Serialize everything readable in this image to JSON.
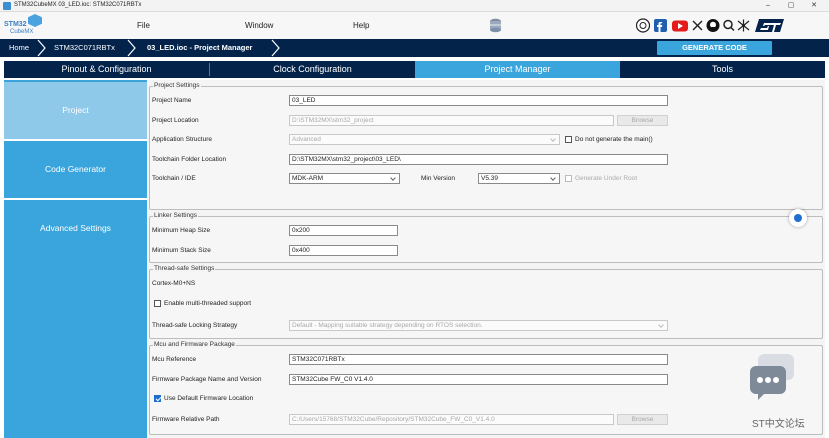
{
  "window": {
    "title": "STM32CubeMX 03_LED.ioc: STM32C071RBTx",
    "minimize": "–",
    "maximize": "▢",
    "close": "✕"
  },
  "logo": {
    "line1": "STM32",
    "line2": "CubeMX"
  },
  "menu": {
    "file": "File",
    "window": "Window",
    "help": "Help"
  },
  "breadcrumb": {
    "home": "Home",
    "mcu": "STM32C071RBTx",
    "project": "03_LED.ioc - Project Manager",
    "generate": "GENERATE CODE"
  },
  "tabs": [
    {
      "label": "Pinout & Configuration"
    },
    {
      "label": "Clock Configuration"
    },
    {
      "label": "Project Manager"
    },
    {
      "label": "Tools"
    }
  ],
  "sidenav": [
    {
      "label": "Project"
    },
    {
      "label": "Code Generator"
    },
    {
      "label": "Advanced Settings"
    }
  ],
  "project_settings": {
    "title": "Project Settings",
    "project_name_label": "Project Name",
    "project_name": "03_LED",
    "project_location_label": "Project Location",
    "project_location": "D:\\STM32MX\\stm32_project",
    "browse": "Browse",
    "app_structure_label": "Application Structure",
    "app_structure": "Advanced",
    "no_main_label": "Do not generate the main()",
    "toolchain_folder_label": "Toolchain Folder Location",
    "toolchain_folder": "D:\\STM32MX\\stm32_project\\03_LED\\",
    "toolchain_ide_label": "Toolchain / IDE",
    "toolchain_ide": "MDK-ARM",
    "min_version_label": "Min Version",
    "min_version": "V5.39",
    "gen_under_root_label": "Generate Under Root"
  },
  "linker_settings": {
    "title": "Linker Settings",
    "heap_label": "Minimum Heap Size",
    "heap": "0x200",
    "stack_label": "Minimum Stack Size",
    "stack": "0x400"
  },
  "thread_safe": {
    "title": "Thread-safe Settings",
    "core": "Cortex-M0+NS",
    "multi_label": "Enable multi-threaded support",
    "strategy_label": "Thread-safe Locking Strategy",
    "strategy": "Default - Mapping suitable strategy depending on RTOS selection."
  },
  "mcu_fw": {
    "title": "Mcu and Firmware Package",
    "mcu_ref_label": "Mcu Reference",
    "mcu_ref": "STM32C071RBTx",
    "fw_name_label": "Firmware Package Name and Version",
    "fw_name": "STM32Cube FW_C0 V1.4.0",
    "default_loc_label": "Use Default Firmware Location",
    "rel_path_label": "Firmware Relative Path",
    "rel_path": "C:/Users/15768/STM32Cube/Repository/STM32Cube_FW_C0_V1.4.0",
    "browse": "Browse"
  },
  "chat_widget": {
    "label": "ST中文论坛"
  },
  "colors": {
    "navy": "#03234b",
    "accent": "#3aa5dc",
    "active_nav": "#8ec9ea",
    "checkbox": "#1e6fd0"
  }
}
